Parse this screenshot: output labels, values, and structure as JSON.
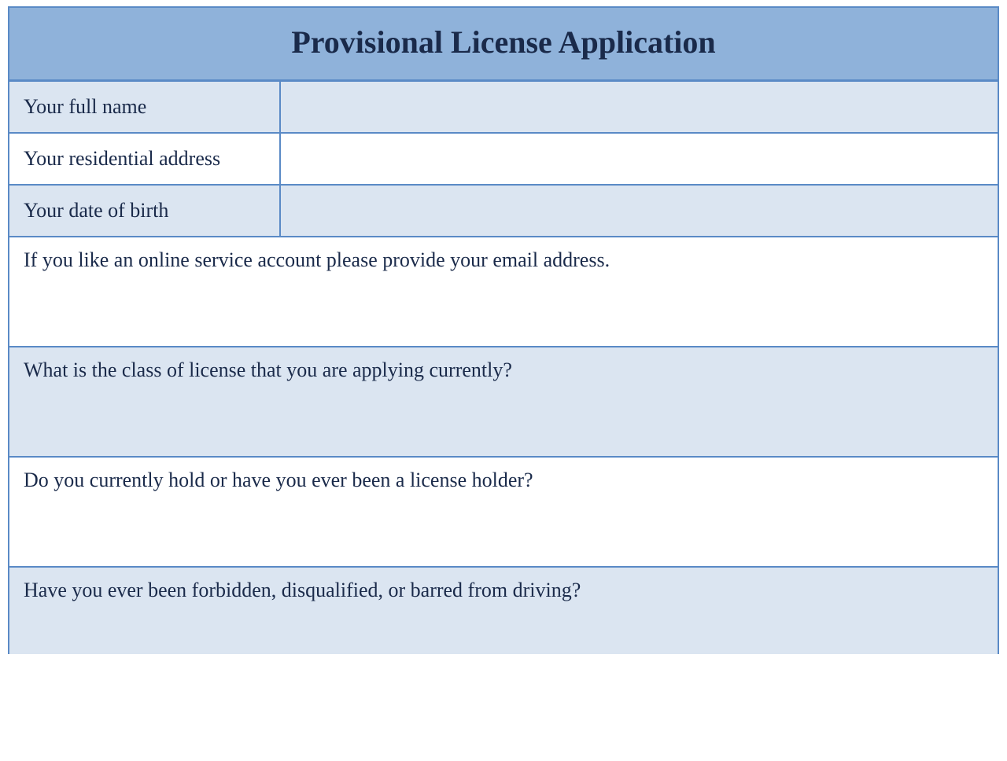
{
  "form": {
    "title": "Provisional License Application",
    "rows": [
      {
        "label": "Your full name"
      },
      {
        "label": "Your residential address"
      },
      {
        "label": "Your date of birth"
      }
    ],
    "questions": [
      "If you like an online service account please provide your email address.",
      "What is the class of license that you are applying currently?",
      "Do you currently hold or have you ever been a license holder?",
      "Have you ever been forbidden, disqualified, or barred from driving?"
    ]
  }
}
